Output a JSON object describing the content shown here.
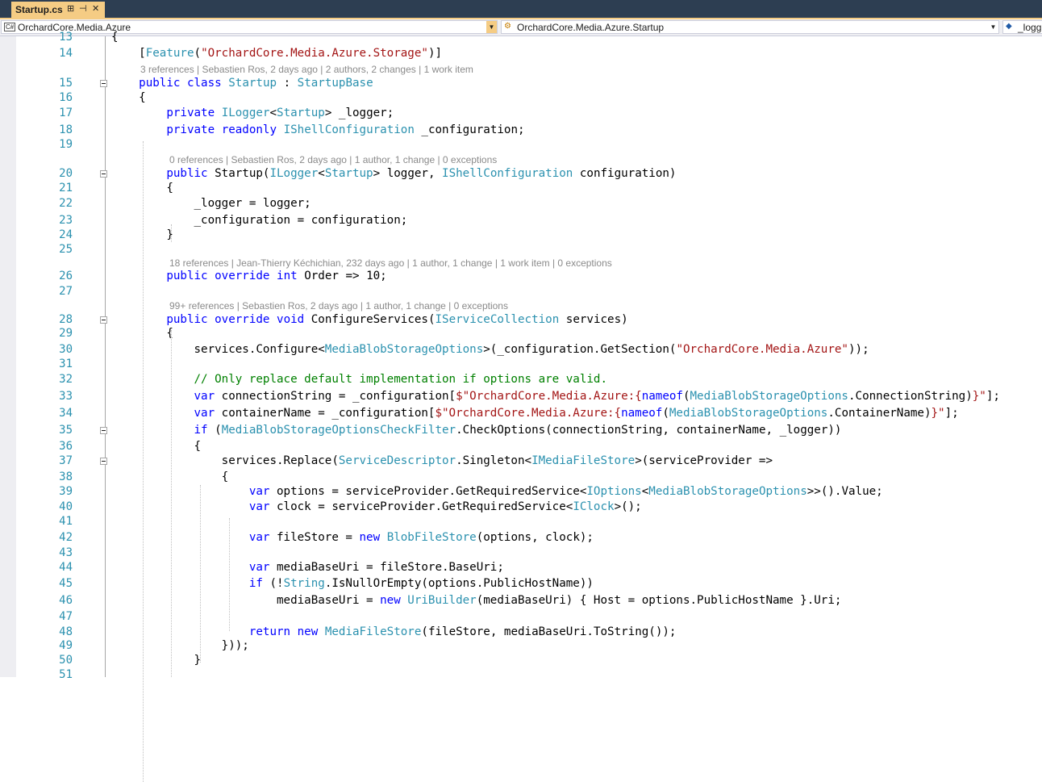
{
  "tab": {
    "title": "Startup.cs",
    "pin_glyph": "⊞",
    "dock_glyph": "⊣",
    "close_glyph": "✕"
  },
  "nav": {
    "project": "OrchardCore.Media.Azure",
    "project_icon": "C#",
    "type": "OrchardCore.Media.Azure.Startup",
    "member": "_logg"
  },
  "code": {
    "lines": [
      {
        "n": "13",
        "html": "{"
      },
      {
        "n": "14",
        "html": "    [<span class='ty'>Feature</span>(<span class='st'>\"OrchardCore.Media.Azure.Storage\"</span>)]"
      },
      {
        "lens": "3 references | Sebastien Ros, 2 days ago | 2 authors, 2 changes | 1 work item",
        "indent": 174
      },
      {
        "n": "15",
        "html": "    <span class='kw'>public</span> <span class='kw'>class</span> <span class='ty'>Startup</span> : <span class='ty'>StartupBase</span>",
        "fold": true
      },
      {
        "n": "16",
        "html": "    {"
      },
      {
        "n": "17",
        "html": "        <span class='kw'>private</span> <span class='ty'>ILogger</span>&lt;<span class='ty'>Startup</span>&gt; _logger;"
      },
      {
        "n": "18",
        "html": "        <span class='kw'>private</span> <span class='kw'>readonly</span> <span class='ty'>IShellConfiguration</span> _configuration;"
      },
      {
        "n": "19",
        "html": ""
      },
      {
        "lens": "0 references | Sebastien Ros, 2 days ago | 1 author, 1 change | 0 exceptions",
        "indent": 210
      },
      {
        "n": "20",
        "html": "        <span class='kw'>public</span> Startup(<span class='ty'>ILogger</span>&lt;<span class='ty'>Startup</span>&gt; logger, <span class='ty'>IShellConfiguration</span> configuration)",
        "fold": true
      },
      {
        "n": "21",
        "html": "        {"
      },
      {
        "n": "22",
        "html": "            _logger = logger;"
      },
      {
        "n": "23",
        "html": "            _configuration = configuration;"
      },
      {
        "n": "24",
        "html": "        }"
      },
      {
        "n": "25",
        "html": ""
      },
      {
        "lens": "18 references | Jean-Thierry Kéchichian, 232 days ago | 1 author, 1 change | 1 work item | 0 exceptions",
        "indent": 210
      },
      {
        "n": "26",
        "html": "        <span class='kw'>public</span> <span class='kw'>override</span> <span class='kw'>int</span> Order =&gt; 10;"
      },
      {
        "n": "27",
        "html": ""
      },
      {
        "lens": "99+ references | Sebastien Ros, 2 days ago | 1 author, 1 change | 0 exceptions",
        "indent": 210
      },
      {
        "n": "28",
        "html": "        <span class='kw'>public</span> <span class='kw'>override</span> <span class='kw'>void</span> ConfigureServices(<span class='ty'>IServiceCollection</span> services)",
        "fold": true
      },
      {
        "n": "29",
        "html": "        {"
      },
      {
        "n": "30",
        "html": "            services.Configure&lt;<span class='ty'>MediaBlobStorageOptions</span>&gt;(_configuration.GetSection(<span class='st'>\"OrchardCore.Media.Azure\"</span>));"
      },
      {
        "n": "31",
        "html": ""
      },
      {
        "n": "32",
        "html": "            <span class='cm'>// Only replace default implementation if options are valid.</span>"
      },
      {
        "n": "33",
        "html": "            <span class='kw'>var</span> connectionString = _configuration[<span class='st'>$\"OrchardCore.Media.Azure:{</span><span class='kw'>nameof</span>(<span class='ty'>MediaBlobStorageOptions</span>.ConnectionString)<span class='st'>}\"</span>];"
      },
      {
        "n": "34",
        "html": "            <span class='kw'>var</span> containerName = _configuration[<span class='st'>$\"OrchardCore.Media.Azure:{</span><span class='kw'>nameof</span>(<span class='ty'>MediaBlobStorageOptions</span>.ContainerName)<span class='st'>}\"</span>];"
      },
      {
        "n": "35",
        "html": "            <span class='kw'>if</span> (<span class='ty'>MediaBlobStorageOptionsCheckFilter</span>.CheckOptions(connectionString, containerName, _logger))",
        "fold": true
      },
      {
        "n": "36",
        "html": "            {"
      },
      {
        "n": "37",
        "html": "                services.Replace(<span class='ty'>ServiceDescriptor</span>.Singleton&lt;<span class='ty'>IMediaFileStore</span>&gt;(serviceProvider =&gt;",
        "fold": true
      },
      {
        "n": "38",
        "html": "                {"
      },
      {
        "n": "39",
        "html": "                    <span class='kw'>var</span> options = serviceProvider.GetRequiredService&lt;<span class='ty'>IOptions</span>&lt;<span class='ty'>MediaBlobStorageOptions</span>&gt;&gt;().Value;"
      },
      {
        "n": "40",
        "html": "                    <span class='kw'>var</span> clock = serviceProvider.GetRequiredService&lt;<span class='ty'>IClock</span>&gt;();"
      },
      {
        "n": "41",
        "html": ""
      },
      {
        "n": "42",
        "html": "                    <span class='kw'>var</span> fileStore = <span class='kw'>new</span> <span class='ty'>BlobFileStore</span>(options, clock);"
      },
      {
        "n": "43",
        "html": ""
      },
      {
        "n": "44",
        "html": "                    <span class='kw'>var</span> mediaBaseUri = fileStore.BaseUri;"
      },
      {
        "n": "45",
        "html": "                    <span class='kw'>if</span> (!<span class='ty'>String</span>.IsNullOrEmpty(options.PublicHostName))"
      },
      {
        "n": "46",
        "html": "                        mediaBaseUri = <span class='kw'>new</span> <span class='ty'>UriBuilder</span>(mediaBaseUri) { Host = options.PublicHostName }.Uri;"
      },
      {
        "n": "47",
        "html": ""
      },
      {
        "n": "48",
        "html": "                    <span class='kw'>return</span> <span class='kw'>new</span> <span class='ty'>MediaFileStore</span>(fileStore, mediaBaseUri.ToString());"
      },
      {
        "n": "49",
        "html": "                }));"
      },
      {
        "n": "50",
        "html": "            }"
      },
      {
        "n": "51",
        "html": ""
      }
    ]
  }
}
